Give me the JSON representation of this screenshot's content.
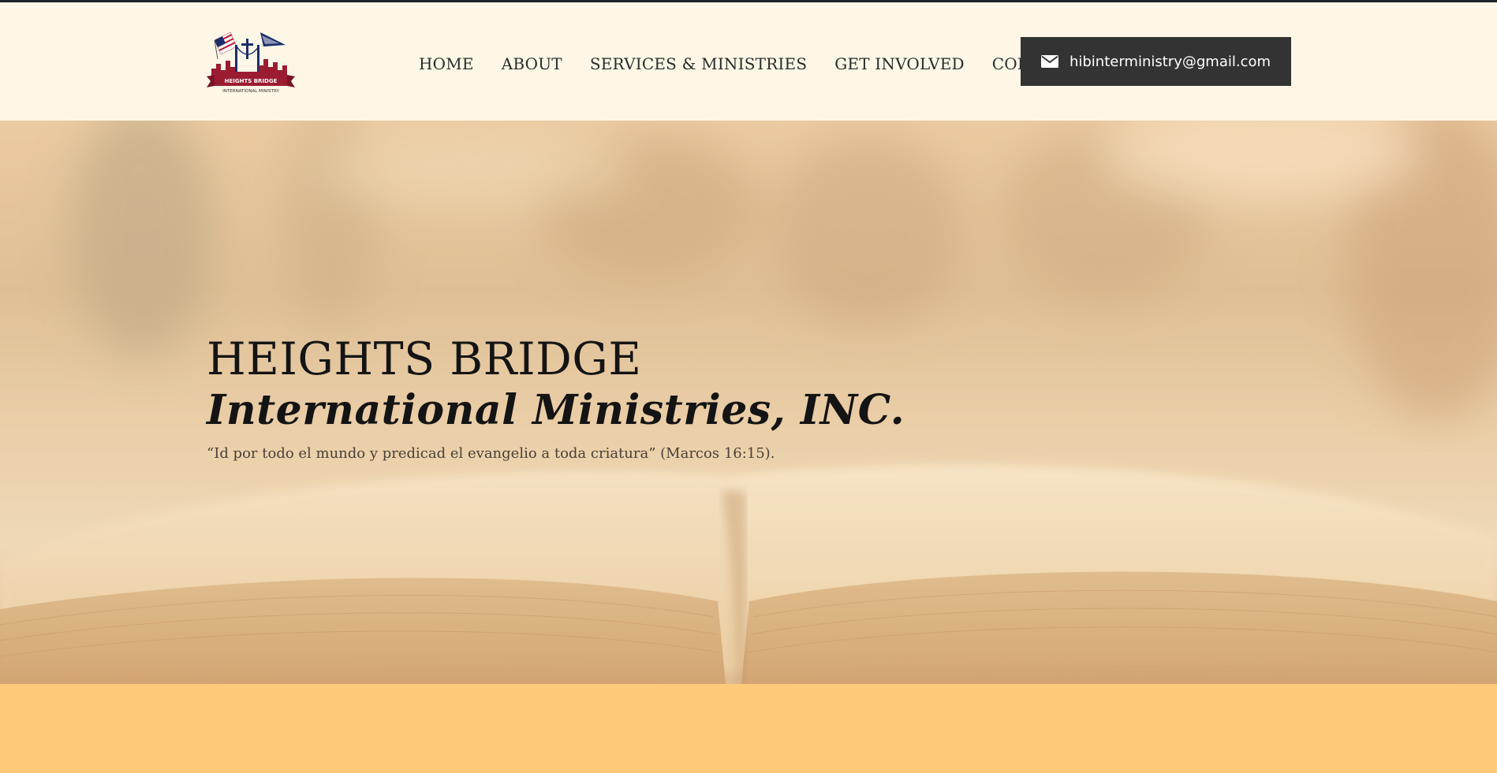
{
  "header": {
    "logo": {
      "name": "Heights Bridge International Ministry logo",
      "caption": "INTERNATIONAL MINISTRY",
      "banner_text": "HEIGHTS BRIDGE"
    },
    "nav": [
      {
        "label": "HOME"
      },
      {
        "label": "ABOUT"
      },
      {
        "label": "SERVICES & MINISTRIES"
      },
      {
        "label": "GET INVOLVED"
      },
      {
        "label": "CONTACT"
      }
    ],
    "email_button": {
      "icon": "envelope-icon",
      "label": "hibinterministry@gmail.com"
    }
  },
  "hero": {
    "title": "HEIGHTS BRIDGE",
    "subtitle": "International Ministries, INC.",
    "verse": "“Id por todo el mundo y predicad el evangelio a toda criatura” (Marcos 16:15).",
    "background": "open-bible-image"
  },
  "colors": {
    "header_bg": "#fef7e7",
    "nav_text": "#2b2b2b",
    "button_bg": "#333333",
    "button_text": "#ffffff",
    "hero_text": "#141414",
    "bottom_band": "#ffc97a",
    "top_border": "#1f2329"
  }
}
